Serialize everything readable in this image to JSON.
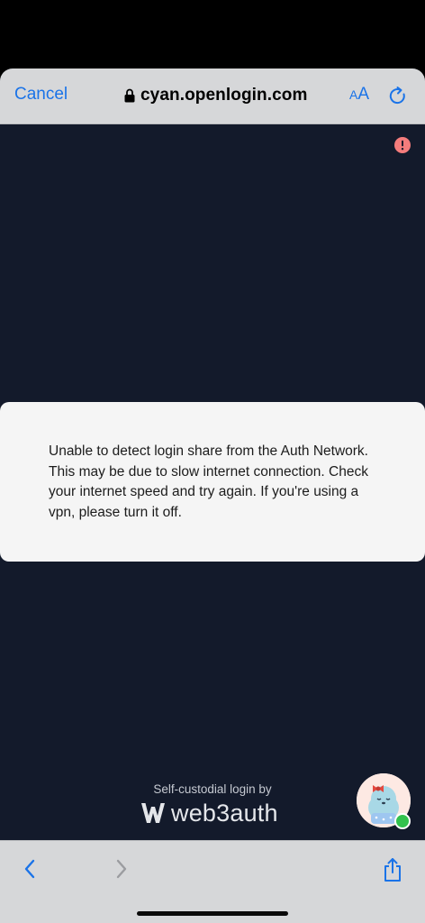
{
  "browser": {
    "cancel_label": "Cancel",
    "url": "cyan.openlogin.com",
    "text_size_label_small": "A",
    "text_size_label_big": "A"
  },
  "dialog": {
    "message": "Unable to detect login share from the Auth Network. This may be due to slow internet connection. Check your internet speed and try again. If you're using a vpn, please turn it off."
  },
  "footer": {
    "label": "Self-custodial login by",
    "brand": "web3auth"
  },
  "colors": {
    "accent": "#1a73e8",
    "page_bg": "#131a2b",
    "alert": "#f47c7c",
    "online": "#33c24d"
  },
  "icons": {
    "lock": "lock-icon",
    "reload": "reload-icon",
    "alert": "alert-icon",
    "back": "chevron-left-icon",
    "forward": "chevron-right-icon",
    "share": "share-icon"
  }
}
